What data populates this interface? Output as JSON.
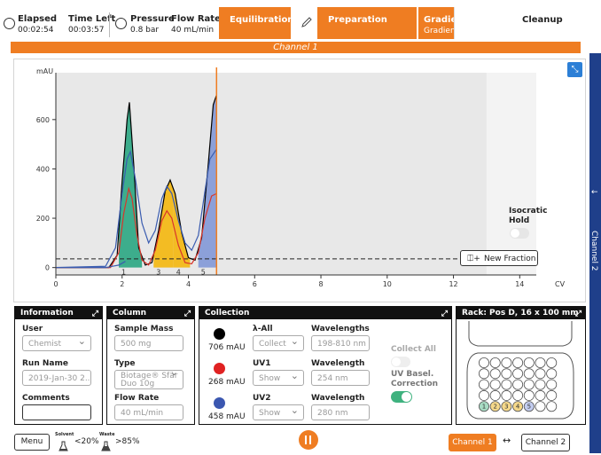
{
  "status": {
    "elapsed_label": "Elapsed",
    "elapsed_value": "00:02:54",
    "time_left_label": "Time Left",
    "time_left_value": "00:03:57",
    "pressure_label": "Pressure",
    "pressure_value": "0.8 bar",
    "flow_rate_label": "Flow Rate",
    "flow_rate_value": "40 mL/min"
  },
  "steps": {
    "equilibration": "Equilibration",
    "preparation": "Preparation",
    "gradient": "Gradient",
    "gradient_sub": "Gradient",
    "cleanup": "Cleanup"
  },
  "channel_title": "Channel 1",
  "side_tab": "Channel 2",
  "chart_data": {
    "type": "line",
    "ylabel": "mAU",
    "xlabel": "CV",
    "xlim": [
      0,
      14.5
    ],
    "ylim": [
      -30,
      790
    ],
    "x_ticks": [
      0,
      2,
      4,
      6,
      8,
      10,
      12,
      14
    ],
    "y_ticks": [
      0,
      200,
      400,
      600
    ],
    "x_tick_labels": [
      "0",
      "2",
      "4",
      "6",
      "8",
      "10",
      "12",
      "14"
    ],
    "y_tick_labels": [
      "0",
      "200",
      "400",
      "600"
    ],
    "current_position": 4.85,
    "threshold": 35,
    "isocratic_start": 13.0,
    "fractions": [
      {
        "label": "1",
        "start": 1.9,
        "end": 2.6,
        "color": "#1fa27b"
      },
      {
        "label": "3",
        "start": 2.95,
        "end": 3.55,
        "color": "#f4b400"
      },
      {
        "label": "4",
        "start": 3.55,
        "end": 4.05,
        "color": "#f4b400"
      },
      {
        "label": "5",
        "start": 4.3,
        "end": 4.85,
        "color": "#7b93d6"
      }
    ],
    "series": [
      {
        "key": "lambda_all",
        "color": "#000000",
        "points": [
          [
            0,
            0
          ],
          [
            1.6,
            0
          ],
          [
            1.85,
            50
          ],
          [
            2.0,
            350
          ],
          [
            2.15,
            600
          ],
          [
            2.22,
            670
          ],
          [
            2.35,
            420
          ],
          [
            2.5,
            80
          ],
          [
            2.7,
            10
          ],
          [
            2.9,
            20
          ],
          [
            3.1,
            150
          ],
          [
            3.3,
            310
          ],
          [
            3.45,
            355
          ],
          [
            3.6,
            300
          ],
          [
            3.8,
            140
          ],
          [
            4.0,
            40
          ],
          [
            4.2,
            30
          ],
          [
            4.4,
            120
          ],
          [
            4.6,
            420
          ],
          [
            4.75,
            660
          ],
          [
            4.85,
            700
          ]
        ]
      },
      {
        "key": "uv2",
        "color": "#3a5cb0",
        "points": [
          [
            0,
            0
          ],
          [
            1.5,
            5
          ],
          [
            1.8,
            80
          ],
          [
            2.0,
            300
          ],
          [
            2.15,
            440
          ],
          [
            2.25,
            470
          ],
          [
            2.4,
            360
          ],
          [
            2.6,
            180
          ],
          [
            2.8,
            100
          ],
          [
            3.0,
            150
          ],
          [
            3.2,
            280
          ],
          [
            3.35,
            330
          ],
          [
            3.5,
            300
          ],
          [
            3.7,
            190
          ],
          [
            3.9,
            100
          ],
          [
            4.1,
            70
          ],
          [
            4.3,
            130
          ],
          [
            4.5,
            310
          ],
          [
            4.65,
            440
          ],
          [
            4.8,
            470
          ],
          [
            4.85,
            480
          ]
        ]
      },
      {
        "key": "uv1",
        "color": "#d9352b",
        "points": [
          [
            0,
            0
          ],
          [
            1.65,
            0
          ],
          [
            1.9,
            60
          ],
          [
            2.05,
            220
          ],
          [
            2.2,
            320
          ],
          [
            2.3,
            280
          ],
          [
            2.45,
            130
          ],
          [
            2.6,
            30
          ],
          [
            2.8,
            10
          ],
          [
            3.0,
            70
          ],
          [
            3.2,
            190
          ],
          [
            3.35,
            230
          ],
          [
            3.5,
            200
          ],
          [
            3.7,
            90
          ],
          [
            3.9,
            20
          ],
          [
            4.1,
            15
          ],
          [
            4.3,
            60
          ],
          [
            4.5,
            200
          ],
          [
            4.7,
            290
          ],
          [
            4.85,
            300
          ]
        ]
      },
      {
        "key": "gradient",
        "color": "#3a5cb0",
        "points": [
          [
            0,
            0
          ],
          [
            1.5,
            0
          ],
          [
            1.9,
            10
          ],
          [
            2.1,
            25
          ]
        ]
      }
    ],
    "annotation": {
      "line1": "Isocratic",
      "line2": "Hold"
    },
    "new_fraction_label": "New Fraction"
  },
  "information": {
    "title": "Information",
    "user_label": "User",
    "user_value": "Chemist",
    "run_name_label": "Run Name",
    "run_name_value": "2019-Jan-30 2...",
    "comments_label": "Comments",
    "comments_value": ""
  },
  "column": {
    "title": "Column",
    "sample_mass_label": "Sample Mass",
    "sample_mass_value": "500 mg",
    "type_label": "Type",
    "type_value_line1": "Biotage® Sfär",
    "type_value_line2": "Duo 10g",
    "flow_rate_label": "Flow Rate",
    "flow_rate_value": "40 mL/min"
  },
  "collection": {
    "title": "Collection",
    "rows": [
      {
        "color": "#000000",
        "mau": "706 mAU",
        "mode_label": "λ-All",
        "mode_value": "Collect",
        "wl_label": "Wavelengths",
        "wl_value": "198-810 nm"
      },
      {
        "color": "#e02222",
        "mau": "268 mAU",
        "mode_label": "UV1",
        "mode_value": "Show",
        "wl_label": "Wavelength",
        "wl_value": "254 nm"
      },
      {
        "color": "#3b57b0",
        "mau": "458 mAU",
        "mode_label": "UV2",
        "mode_value": "Show",
        "wl_label": "Wavelength",
        "wl_value": "280 nm"
      }
    ],
    "collect_all_label": "Collect All",
    "uv_baseline_label_1": "UV Basel.",
    "uv_baseline_label_2": "Correction"
  },
  "rack": {
    "title": "Rack: Pos D, 16 x 100 mm",
    "tubes": [
      {
        "label": "1",
        "color": "#a8dcc4"
      },
      {
        "label": "2",
        "color": "#f5d88a"
      },
      {
        "label": "3",
        "color": "#f5d88a"
      },
      {
        "label": "4",
        "color": "#f5d88a"
      },
      {
        "label": "5",
        "color": "#c3cdf0"
      }
    ]
  },
  "footer": {
    "menu_label": "Menu",
    "solvent_label": "Solvent",
    "solvent_value": "<20%",
    "waste_label": "Waste",
    "waste_value": ">85%",
    "channel1_label": "Channel 1",
    "swap_symbol": "↔",
    "channel2_label": "Channel 2"
  },
  "colors": {
    "accent": "#ef7d22",
    "toggle_on": "#3fb27f",
    "side_tab": "#1f3f8a"
  }
}
